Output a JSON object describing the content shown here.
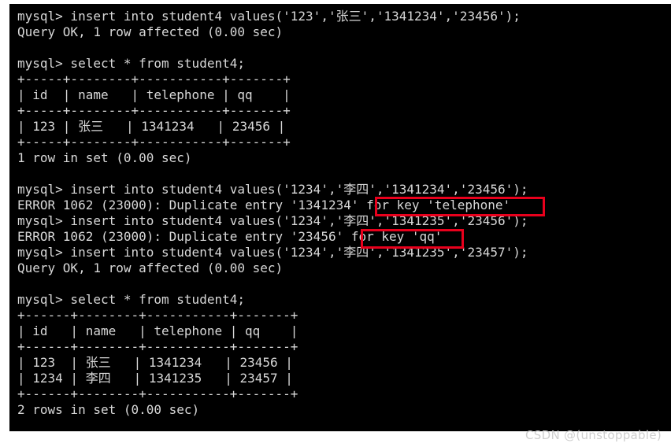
{
  "terminal": {
    "prompt": "mysql> ",
    "background_color": "#000000",
    "text_color": "#d8d8d8",
    "lines": [
      "mysql> insert into student4 values('123','张三','1341234','23456');",
      "Query OK, 1 row affected (0.00 sec)",
      "",
      "mysql> select * from student4;",
      "+-----+--------+-----------+-------+",
      "| id  | name   | telephone | qq    |",
      "+-----+--------+-----------+-------+",
      "| 123 | 张三   | 1341234   | 23456 |",
      "+-----+--------+-----------+-------+",
      "1 row in set (0.00 sec)",
      "",
      "mysql> insert into student4 values('1234','李四','1341234','23456');",
      "ERROR 1062 (23000): Duplicate entry '1341234' for key 'telephone'",
      "mysql> insert into student4 values('1234','李四','1341235','23456');",
      "ERROR 1062 (23000): Duplicate entry '23456' for key 'qq'",
      "mysql> insert into student4 values('1234','李四','1341235','23457');",
      "Query OK, 1 row affected (0.00 sec)",
      "",
      "mysql> select * from student4;",
      "+------+--------+-----------+-------+",
      "| id   | name   | telephone | qq    |",
      "+------+--------+-----------+-------+",
      "| 123  | 张三   | 1341234   | 23456 |",
      "| 1234 | 李四   | 1341235   | 23457 |",
      "+------+--------+-----------+-------+",
      "2 rows in set (0.00 sec)"
    ]
  },
  "annotations": {
    "color": "#e8001c",
    "boxes": [
      {
        "id": "annot-telephone",
        "label": "for key 'telephone'"
      },
      {
        "id": "annot-qq",
        "label": "for key 'qq'"
      }
    ]
  },
  "watermark": {
    "text": "CSDN @(unstoppable)",
    "color": "#cfcfcf"
  },
  "session": {
    "table_name": "student4",
    "first_select_rows": 1,
    "second_select_rows": 2,
    "error_code": "1062",
    "sqlstate": "23000",
    "columns": [
      "id",
      "name",
      "telephone",
      "qq"
    ],
    "first_result_rows": [
      [
        "123",
        "张三",
        "1341234",
        "23456"
      ]
    ],
    "second_result_rows": [
      [
        "123",
        "张三",
        "1341234",
        "23456"
      ],
      [
        "1234",
        "李四",
        "1341235",
        "23457"
      ]
    ]
  }
}
